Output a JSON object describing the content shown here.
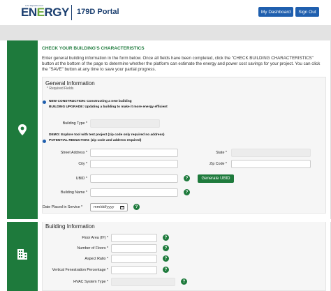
{
  "header": {
    "logo_small": "U.S. Department of",
    "logo_main_pre": "EN",
    "logo_main_mid": "E",
    "logo_main_post": "RGY",
    "portal_title": "179D Portal",
    "dashboard_button": "My Dashboard",
    "signout_button": "Sign Out"
  },
  "characteristics": {
    "heading": "CHECK YOUR BUILDING'S CHARACTERISTICS",
    "intro": "Enter general building information in the form below. Once all fields have been completed, click the \"CHECK BUILDING CHARACTERISTICS\" button at the bottom of the page to determine whether the platform can estimate the energy and power cost savings for your project. You can click the \"SAVE\" button at any time to save your partial progress."
  },
  "general": {
    "title": "General Information",
    "required_note": "* Required Fields",
    "option1_line1": "NEW CONSTRUCTION: Constructing a new building",
    "option1_line2": "BUILDING UPGRADE: Updating a building to make it more energy efficient",
    "building_type_label": "Building Type *",
    "option2_line1": "DEMO: Explore tool with test project (zip code only required no address)",
    "option2_line2": "POTENTIAL REDUCTION: (zip code and address required)",
    "street_label": "Street Address *",
    "state_label": "State *",
    "city_label": "City *",
    "zip_label": "Zip Code *",
    "ubid_label": "UBID *",
    "generate_button": "Generate UBID",
    "building_name_label": "Building Name *",
    "date_label": "Date Placed in Service *",
    "date_placeholder": "mm/dd/yyyy",
    "help_glyph": "?"
  },
  "building": {
    "title": "Building Information",
    "floor_area_label": "Floor Area (ft²) *",
    "floors_label": "Number of Floors *",
    "aspect_label": "Aspect Ratio *",
    "fenestration_label": "Vertical Fenestration Percentage *",
    "hvac_label": "HVAC System Type *"
  },
  "icons": {
    "location": "location-pin-icon",
    "building": "building-icon",
    "calendar": "calendar-icon"
  },
  "colors": {
    "green": "#1e7a3c",
    "blue": "#1f5fae",
    "navy": "#1a3e6f"
  }
}
